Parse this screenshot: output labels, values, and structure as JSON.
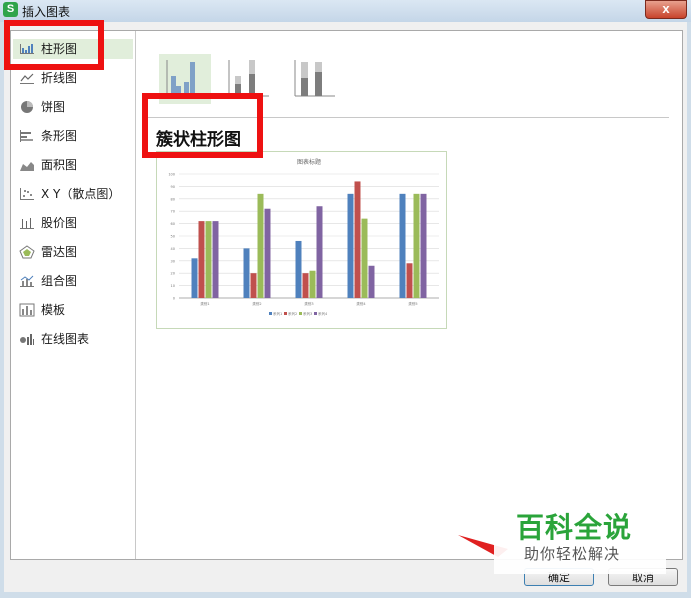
{
  "window": {
    "title": "插入图表",
    "app_icon_letter": "S",
    "close_glyph": "x"
  },
  "sidebar": {
    "items": [
      {
        "label": "柱形图",
        "icon": "column-chart-icon",
        "selected": true
      },
      {
        "label": "折线图",
        "icon": "line-chart-icon"
      },
      {
        "label": "饼图",
        "icon": "pie-chart-icon"
      },
      {
        "label": "条形图",
        "icon": "bar-chart-icon"
      },
      {
        "label": "面积图",
        "icon": "area-chart-icon"
      },
      {
        "label": "X Y（散点图）",
        "icon": "scatter-chart-icon"
      },
      {
        "label": "股价图",
        "icon": "stock-chart-icon"
      },
      {
        "label": "雷达图",
        "icon": "radar-chart-icon"
      },
      {
        "label": "组合图",
        "icon": "combo-chart-icon"
      },
      {
        "label": "模板",
        "icon": "template-icon"
      },
      {
        "label": "在线图表",
        "icon": "online-chart-icon"
      }
    ]
  },
  "subtypes": [
    {
      "name": "clustered-column",
      "selected": true
    },
    {
      "name": "stacked-column"
    },
    {
      "name": "percent-stacked-column"
    }
  ],
  "subtype_title": "簇状柱形图",
  "preview": {
    "chart_data": {
      "type": "bar",
      "title": "图表标题",
      "categories": [
        "类别1",
        "类别2",
        "类别3",
        "类别4",
        "类别5"
      ],
      "series": [
        {
          "name": "系列1",
          "values": [
            32,
            40,
            46,
            84,
            84
          ]
        },
        {
          "name": "系列2",
          "values": [
            62,
            20,
            20,
            94,
            28
          ]
        },
        {
          "name": "系列3",
          "values": [
            62,
            84,
            22,
            64,
            84
          ]
        },
        {
          "name": "系列4",
          "values": [
            62,
            72,
            74,
            26,
            84
          ]
        }
      ],
      "ylim": [
        0,
        100
      ],
      "yticks": [
        0,
        10,
        20,
        30,
        40,
        50,
        60,
        70,
        80,
        90,
        100
      ],
      "colors": [
        "#4f81bd",
        "#c0504d",
        "#9bbb59",
        "#8064a2"
      ],
      "grid": true,
      "legend": "bottom"
    }
  },
  "buttons": {
    "ok": "确定",
    "cancel": "取消"
  },
  "watermark": {
    "title": "百科全说",
    "subtitle": "助你轻松解决"
  },
  "colors": {
    "highlight": "#ee1111",
    "selection": "#e1eedb",
    "watermark_green": "#2aa43a"
  }
}
